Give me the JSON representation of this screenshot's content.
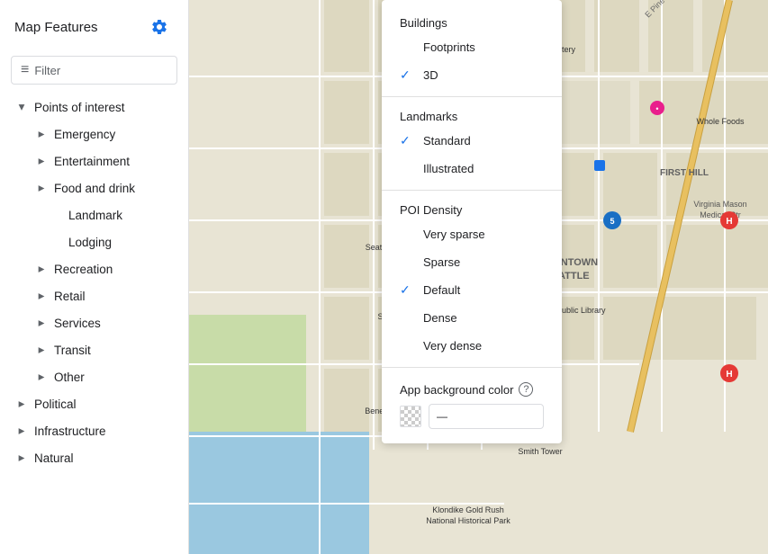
{
  "sidebar": {
    "title": "Map Features",
    "filter_placeholder": "Filter",
    "items": [
      {
        "id": "points-of-interest",
        "label": "Points of interest",
        "level": 1,
        "has_chevron": true,
        "expanded": true
      },
      {
        "id": "emergency",
        "label": "Emergency",
        "level": 2,
        "has_chevron": true
      },
      {
        "id": "entertainment",
        "label": "Entertainment",
        "level": 2,
        "has_chevron": true
      },
      {
        "id": "food-and-drink",
        "label": "Food and drink",
        "level": 2,
        "has_chevron": true
      },
      {
        "id": "landmark",
        "label": "Landmark",
        "level": 2,
        "has_chevron": false,
        "indent": true
      },
      {
        "id": "lodging",
        "label": "Lodging",
        "level": 2,
        "has_chevron": false,
        "indent": true
      },
      {
        "id": "recreation",
        "label": "Recreation",
        "level": 2,
        "has_chevron": true
      },
      {
        "id": "retail",
        "label": "Retail",
        "level": 2,
        "has_chevron": true
      },
      {
        "id": "services",
        "label": "Services",
        "level": 2,
        "has_chevron": true
      },
      {
        "id": "transit",
        "label": "Transit",
        "level": 2,
        "has_chevron": true
      },
      {
        "id": "other",
        "label": "Other",
        "level": 2,
        "has_chevron": true
      },
      {
        "id": "political",
        "label": "Political",
        "level": 1,
        "has_chevron": true
      },
      {
        "id": "infrastructure",
        "label": "Infrastructure",
        "level": 1,
        "has_chevron": true
      },
      {
        "id": "natural",
        "label": "Natural",
        "level": 1,
        "has_chevron": true
      }
    ]
  },
  "dropdown": {
    "sections": [
      {
        "title": "Buildings",
        "items": [
          {
            "id": "footprints",
            "label": "Footprints",
            "checked": false
          },
          {
            "id": "3d",
            "label": "3D",
            "checked": true
          }
        ]
      },
      {
        "title": "Landmarks",
        "items": [
          {
            "id": "standard",
            "label": "Standard",
            "checked": true
          },
          {
            "id": "illustrated",
            "label": "Illustrated",
            "checked": false
          }
        ]
      },
      {
        "title": "POI Density",
        "items": [
          {
            "id": "very-sparse",
            "label": "Very sparse",
            "checked": false
          },
          {
            "id": "sparse",
            "label": "Sparse",
            "checked": false
          },
          {
            "id": "default",
            "label": "Default",
            "checked": true
          },
          {
            "id": "dense",
            "label": "Dense",
            "checked": false
          },
          {
            "id": "very-dense",
            "label": "Very dense",
            "checked": false
          }
        ]
      }
    ],
    "app_background": {
      "label": "App background color",
      "value": "—"
    }
  },
  "gear_icon": "⚙",
  "filter_icon": "≡",
  "chevron_right": "▸",
  "chevron_down": "▾",
  "check_mark": "✓"
}
